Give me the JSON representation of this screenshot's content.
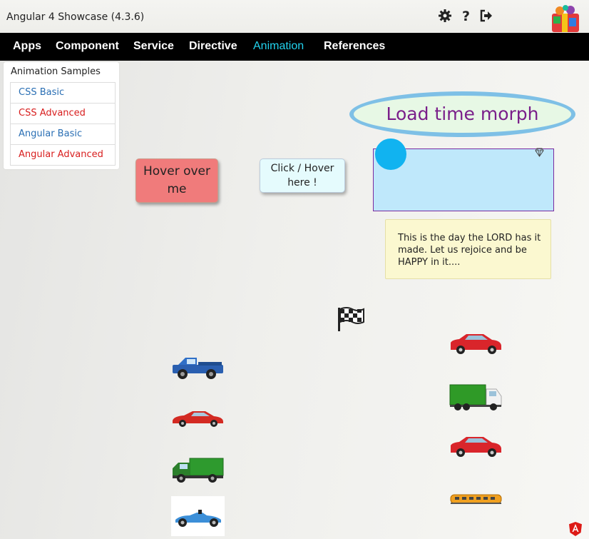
{
  "header": {
    "title": "Angular 4 Showcase (4.3.6)",
    "icons": [
      "gear-icon",
      "help-icon",
      "sign-out-icon",
      "gift-logo"
    ]
  },
  "nav": {
    "items": [
      "Apps",
      "Component",
      "Service",
      "Directive",
      "Animation",
      "References"
    ],
    "active": "Animation",
    "active_color": "#22d3ee"
  },
  "sidebar": {
    "title": "Animation Samples",
    "items": [
      {
        "label": "CSS Basic",
        "color": "#2a6fb4"
      },
      {
        "label": "CSS Advanced",
        "color": "#d81e1e"
      },
      {
        "label": "Angular Basic",
        "color": "#2a6fb4"
      },
      {
        "label": "Angular Advanced",
        "color": "#d81e1e"
      }
    ]
  },
  "demo": {
    "hover_label": "Hover over me",
    "click_label": "Click / Hover here !",
    "morph_label": "Load time morph",
    "note_text": "This is the day the LORD has it made. Let us rejoice and be HAPPY in it....",
    "icons": [
      "diamond-icon",
      "checkered-flag-icon",
      "angular-icon"
    ]
  },
  "colors": {
    "hover_box": "#f07b7b",
    "morph_text": "#7a1f8a",
    "dot": "#11b3f0"
  }
}
